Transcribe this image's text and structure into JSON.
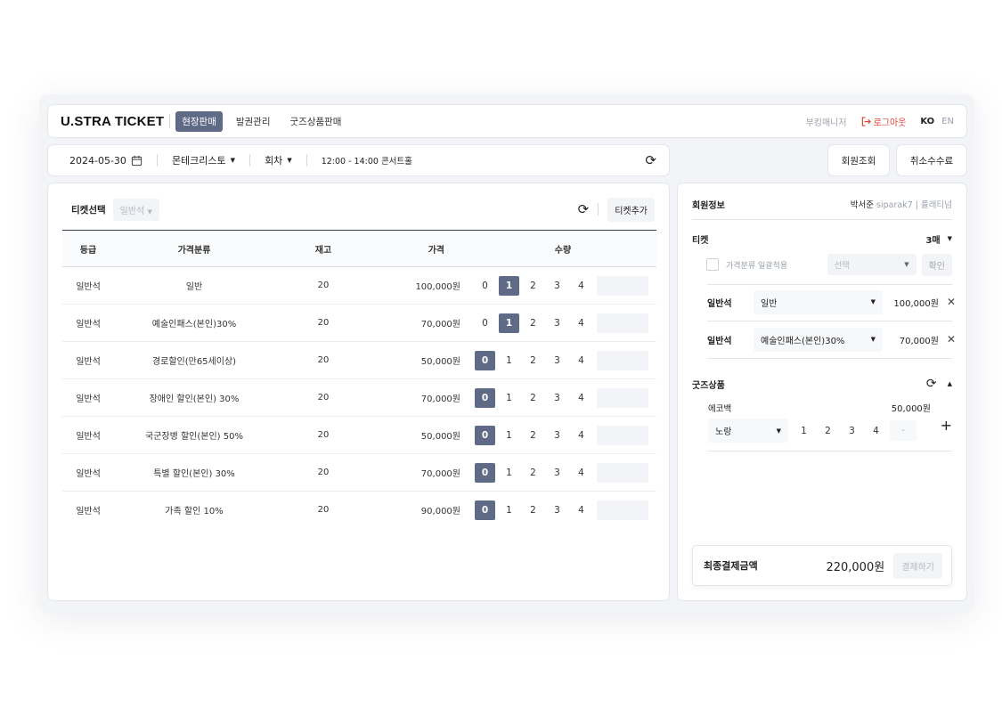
{
  "header": {
    "logo": "U.STRA TICKET",
    "nav": [
      "현장판매",
      "발권관리",
      "굿즈상품판매"
    ],
    "partner": "부킹매니저",
    "logout": "로그아웃",
    "lang_ko": "KO",
    "lang_en": "EN"
  },
  "filters": {
    "date": "2024-05-30",
    "performance": "몬테크리스토",
    "session": "회차",
    "time": "12:00 - 14:00 콘서트홀"
  },
  "top_buttons": {
    "member_search": "회원조회",
    "cancel_fee": "취소수수료"
  },
  "ticket_panel": {
    "title": "티켓선택",
    "seat_select": "일반석",
    "add_button": "티켓추가",
    "columns": [
      "등급",
      "가격분류",
      "재고",
      "가격",
      "수량"
    ],
    "rows": [
      {
        "grade": "일반석",
        "category": "일반",
        "stock": "20",
        "price": "100,000원",
        "selected": "1"
      },
      {
        "grade": "일반석",
        "category": "예술인패스(본인)30%",
        "stock": "20",
        "price": "70,000원",
        "selected": "1"
      },
      {
        "grade": "일반석",
        "category": "경로할인(만65세이상)",
        "stock": "20",
        "price": "50,000원",
        "selected": "0"
      },
      {
        "grade": "일반석",
        "category": "장애인 할인(본인) 30%",
        "stock": "20",
        "price": "70,000원",
        "selected": "0"
      },
      {
        "grade": "일반석",
        "category": "국군장병 할인(본인) 50%",
        "stock": "20",
        "price": "50,000원",
        "selected": "0"
      },
      {
        "grade": "일반석",
        "category": "특별 할인(본인) 30%",
        "stock": "20",
        "price": "70,000원",
        "selected": "0"
      },
      {
        "grade": "일반석",
        "category": "가족 할인 10%",
        "stock": "20",
        "price": "90,000원",
        "selected": "0"
      }
    ],
    "qty_options": [
      "0",
      "1",
      "2",
      "3",
      "4"
    ]
  },
  "right_panel": {
    "member_title": "회원정보",
    "member_name": "박서준",
    "member_id": "siparak7",
    "member_grade": "플래티넘",
    "ticket_title": "티켓",
    "ticket_count": "3매",
    "bulk_label": "가격분류 일괄적용",
    "bulk_select": "선택",
    "bulk_confirm": "확인",
    "items": [
      {
        "grade": "일반석",
        "category": "일반",
        "price": "100,000원"
      },
      {
        "grade": "일반석",
        "category": "예술인패스(본인)30%",
        "price": "70,000원"
      }
    ],
    "goods_title": "굿즈상품",
    "goods_name": "에코백",
    "goods_price": "50,000원",
    "goods_option": "노랑",
    "goods_qty": [
      "1",
      "2",
      "3",
      "4"
    ],
    "goods_input": "-",
    "total_label": "최종결제금액",
    "total_amount": "220,000원",
    "pay_button": "결제하기"
  },
  "colors": {
    "accent": "#5f6b86",
    "logout": "#e0433a",
    "background": "#f3f4f7"
  }
}
